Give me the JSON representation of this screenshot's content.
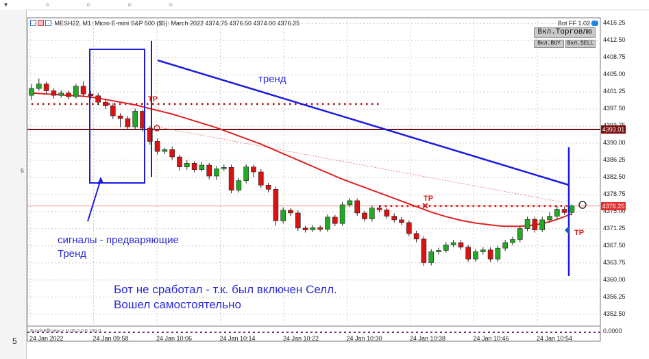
{
  "header": {
    "symbol": "MESH22, M1:",
    "description": "Micro E-mini S&P 500 ($5): March 2022",
    "ohlc": "4374.75 4376.50 4374.00 4376.25"
  },
  "bot": {
    "name": "Bot FF 1.02",
    "trade_button": "Вкл.Торговлю",
    "buy_button": "Вкл.BUY",
    "sell_button": "Вкл.SELL"
  },
  "price_axis": {
    "labels": [
      "4416.25",
      "4412.50",
      "4408.75",
      "4405.00",
      "4401.25",
      "4397.50",
      "4393.75",
      "4390.00",
      "4386.25",
      "4382.50",
      "4378.75",
      "4375.00",
      "4371.25",
      "4367.50",
      "4363.75",
      "4360.00",
      "4356.25",
      "4352.50"
    ],
    "tag_dark": "4393.01",
    "tag_red": "4376.25",
    "bottom_label": "0.0000"
  },
  "time_axis": [
    "24 Jan 2022",
    "24 Jan 09:58",
    "24 Jan 10:06",
    "24 Jan 10:14",
    "24 Jan 10:22",
    "24 Jan 10:30",
    "24 Jan 10:38",
    "24 Jan 10:46",
    "24 Jan 10:54"
  ],
  "annotations": {
    "trend": "тренд",
    "signals_line1": "сигналы - предваряющие",
    "signals_line2": "Тренд",
    "bot_line1": "Бот не сработал - т.к. был включен Селл.",
    "bot_line2": "Вошел самостоятельно",
    "tp": "TP"
  },
  "indicator_label": "FundsEfficiency 1105 0.0 0.100.0",
  "left_marks": [
    "6"
  ],
  "page_number": "5",
  "colors": {
    "bull": "#22aa22",
    "bear": "#dd1111",
    "annotation": "#1a1ae0",
    "ma": "#e02020",
    "dark_level": "#7a0e0e"
  },
  "chart_data": {
    "type": "candlestick",
    "ylim": [
      4350.5,
      4417.5
    ],
    "candles": [
      {
        "o": 4400.5,
        "c": 4402.0,
        "h": 4403.0,
        "l": 4399.5
      },
      {
        "o": 4402.0,
        "c": 4403.0,
        "h": 4404.2,
        "l": 4401.5
      },
      {
        "o": 4403.0,
        "c": 4401.5,
        "h": 4403.5,
        "l": 4400.8
      },
      {
        "o": 4401.5,
        "c": 4400.5,
        "h": 4402.0,
        "l": 4399.8
      },
      {
        "o": 4400.5,
        "c": 4401.0,
        "h": 4401.6,
        "l": 4400.0
      },
      {
        "o": 4401.0,
        "c": 4400.2,
        "h": 4401.5,
        "l": 4399.6
      },
      {
        "o": 4400.2,
        "c": 4402.5,
        "h": 4403.0,
        "l": 4399.8
      },
      {
        "o": 4402.5,
        "c": 4400.8,
        "h": 4403.6,
        "l": 4400.3
      },
      {
        "o": 4400.8,
        "c": 4400.4,
        "h": 4401.4,
        "l": 4399.8
      },
      {
        "o": 4400.4,
        "c": 4399.0,
        "h": 4401.0,
        "l": 4398.4
      },
      {
        "o": 4399.0,
        "c": 4398.2,
        "h": 4399.6,
        "l": 4397.5
      },
      {
        "o": 4398.2,
        "c": 4396.0,
        "h": 4398.8,
        "l": 4395.3
      },
      {
        "o": 4396.0,
        "c": 4395.4,
        "h": 4396.6,
        "l": 4393.5
      },
      {
        "o": 4395.4,
        "c": 4393.6,
        "h": 4396.0,
        "l": 4392.9
      },
      {
        "o": 4393.6,
        "c": 4397.0,
        "h": 4397.6,
        "l": 4393.0
      },
      {
        "o": 4397.0,
        "c": 4393.3,
        "h": 4397.3,
        "l": 4392.5
      },
      {
        "o": 4393.3,
        "c": 4390.4,
        "h": 4393.8,
        "l": 4389.7
      },
      {
        "o": 4390.4,
        "c": 4388.2,
        "h": 4391.0,
        "l": 4387.5
      },
      {
        "o": 4388.2,
        "c": 4388.6,
        "h": 4389.0,
        "l": 4387.6
      },
      {
        "o": 4388.6,
        "c": 4387.0,
        "h": 4389.3,
        "l": 4386.4
      },
      {
        "o": 4387.0,
        "c": 4384.8,
        "h": 4387.5,
        "l": 4384.0
      },
      {
        "o": 4384.8,
        "c": 4385.6,
        "h": 4386.3,
        "l": 4384.2
      },
      {
        "o": 4385.6,
        "c": 4384.2,
        "h": 4386.1,
        "l": 4383.6
      },
      {
        "o": 4384.2,
        "c": 4385.2,
        "h": 4385.9,
        "l": 4383.8
      },
      {
        "o": 4385.2,
        "c": 4382.8,
        "h": 4385.7,
        "l": 4382.1
      },
      {
        "o": 4382.8,
        "c": 4384.4,
        "h": 4385.0,
        "l": 4382.0
      },
      {
        "o": 4384.4,
        "c": 4384.7,
        "h": 4385.3,
        "l": 4383.9
      },
      {
        "o": 4384.7,
        "c": 4379.7,
        "h": 4385.3,
        "l": 4379.0
      },
      {
        "o": 4379.7,
        "c": 4381.8,
        "h": 4382.4,
        "l": 4379.2
      },
      {
        "o": 4381.8,
        "c": 4384.8,
        "h": 4385.4,
        "l": 4381.2
      },
      {
        "o": 4384.8,
        "c": 4383.7,
        "h": 4385.3,
        "l": 4382.6
      },
      {
        "o": 4383.7,
        "c": 4380.8,
        "h": 4384.3,
        "l": 4380.2
      },
      {
        "o": 4380.8,
        "c": 4379.9,
        "h": 4381.3,
        "l": 4379.2
      },
      {
        "o": 4379.9,
        "c": 4373.0,
        "h": 4380.5,
        "l": 4371.9
      },
      {
        "o": 4373.0,
        "c": 4375.3,
        "h": 4375.9,
        "l": 4372.4
      },
      {
        "o": 4375.3,
        "c": 4374.7,
        "h": 4375.8,
        "l": 4374.0
      },
      {
        "o": 4374.7,
        "c": 4371.4,
        "h": 4375.3,
        "l": 4370.8
      },
      {
        "o": 4371.4,
        "c": 4371.0,
        "h": 4371.9,
        "l": 4370.4
      },
      {
        "o": 4371.0,
        "c": 4371.5,
        "h": 4372.1,
        "l": 4370.5
      },
      {
        "o": 4371.5,
        "c": 4371.1,
        "h": 4372.0,
        "l": 4370.6
      },
      {
        "o": 4371.1,
        "c": 4373.8,
        "h": 4374.4,
        "l": 4370.6
      },
      {
        "o": 4373.8,
        "c": 4372.4,
        "h": 4374.3,
        "l": 4371.8
      },
      {
        "o": 4372.4,
        "c": 4376.5,
        "h": 4377.1,
        "l": 4371.9
      },
      {
        "o": 4376.5,
        "c": 4377.4,
        "h": 4378.0,
        "l": 4376.0
      },
      {
        "o": 4377.4,
        "c": 4374.7,
        "h": 4377.9,
        "l": 4374.1
      },
      {
        "o": 4374.7,
        "c": 4373.4,
        "h": 4375.2,
        "l": 4372.8
      },
      {
        "o": 4373.4,
        "c": 4375.8,
        "h": 4376.4,
        "l": 4372.8
      },
      {
        "o": 4375.8,
        "c": 4375.4,
        "h": 4376.4,
        "l": 4374.8
      },
      {
        "o": 4375.4,
        "c": 4374.0,
        "h": 4375.9,
        "l": 4373.4
      },
      {
        "o": 4374.0,
        "c": 4373.2,
        "h": 4374.6,
        "l": 4372.6
      },
      {
        "o": 4373.2,
        "c": 4372.6,
        "h": 4373.8,
        "l": 4372.0
      },
      {
        "o": 4372.6,
        "c": 4370.2,
        "h": 4373.1,
        "l": 4369.6
      },
      {
        "o": 4370.2,
        "c": 4369.0,
        "h": 4370.8,
        "l": 4368.3
      },
      {
        "o": 4369.0,
        "c": 4363.8,
        "h": 4369.6,
        "l": 4363.1
      },
      {
        "o": 4363.8,
        "c": 4366.2,
        "h": 4366.8,
        "l": 4363.2
      },
      {
        "o": 4366.2,
        "c": 4366.5,
        "h": 4367.1,
        "l": 4365.6
      },
      {
        "o": 4366.5,
        "c": 4367.7,
        "h": 4368.3,
        "l": 4366.0
      },
      {
        "o": 4367.7,
        "c": 4368.2,
        "h": 4368.8,
        "l": 4367.2
      },
      {
        "o": 4368.2,
        "c": 4367.2,
        "h": 4368.8,
        "l": 4366.6
      },
      {
        "o": 4367.2,
        "c": 4364.6,
        "h": 4367.7,
        "l": 4364.0
      },
      {
        "o": 4364.6,
        "c": 4366.2,
        "h": 4366.8,
        "l": 4364.0
      },
      {
        "o": 4366.2,
        "c": 4366.6,
        "h": 4367.2,
        "l": 4365.6
      },
      {
        "o": 4366.6,
        "c": 4364.6,
        "h": 4367.2,
        "l": 4364.0
      },
      {
        "o": 4364.6,
        "c": 4367.0,
        "h": 4367.6,
        "l": 4364.0
      },
      {
        "o": 4367.0,
        "c": 4368.2,
        "h": 4368.8,
        "l": 4366.4
      },
      {
        "o": 4368.2,
        "c": 4368.9,
        "h": 4369.5,
        "l": 4367.6
      },
      {
        "o": 4368.9,
        "c": 4371.3,
        "h": 4371.9,
        "l": 4368.3
      },
      {
        "o": 4371.3,
        "c": 4373.3,
        "h": 4373.9,
        "l": 4370.7
      },
      {
        "o": 4373.3,
        "c": 4371.0,
        "h": 4373.9,
        "l": 4370.4
      },
      {
        "o": 4371.0,
        "c": 4373.2,
        "h": 4373.9,
        "l": 4370.5
      },
      {
        "o": 4373.2,
        "c": 4374.0,
        "h": 4374.9,
        "l": 4372.6
      },
      {
        "o": 4374.0,
        "c": 4375.5,
        "h": 4376.2,
        "l": 4373.3
      },
      {
        "o": 4375.5,
        "c": 4374.8,
        "h": 4376.1,
        "l": 4374.3
      },
      {
        "o": 4374.8,
        "c": 4376.3,
        "h": 4376.6,
        "l": 4374.2
      }
    ],
    "ma": [
      4401.0,
      4400.9,
      4400.8,
      4400.7,
      4400.6,
      4400.5,
      4400.4,
      4400.3,
      4400.1,
      4399.9,
      4399.6,
      4399.3,
      4399.0,
      4398.7,
      4398.4,
      4398.0,
      4397.6,
      4397.2,
      4396.8,
      4396.4,
      4395.9,
      4395.4,
      4394.9,
      4394.4,
      4393.9,
      4393.4,
      4392.8,
      4392.2,
      4391.6,
      4391.0,
      4390.4,
      4389.8,
      4389.1,
      4388.4,
      4387.7,
      4387.0,
      4386.3,
      4385.6,
      4384.9,
      4384.2,
      4383.5,
      4382.8,
      4382.1,
      4381.5,
      4380.9,
      4380.3,
      4379.7,
      4379.1,
      4378.5,
      4377.9,
      4377.3,
      4376.7,
      4376.1,
      4375.5,
      4374.9,
      4374.4,
      4373.9,
      4373.5,
      4373.1,
      4372.8,
      4372.5,
      4372.3,
      4372.1,
      4371.9,
      4371.8,
      4371.8,
      4371.8,
      4371.9,
      4372.1,
      4372.4,
      4372.8,
      4373.3,
      4373.9,
      4374.5
    ],
    "levels": [
      {
        "price": 4393.01,
        "style": "solid",
        "color": "#7a0e0e"
      },
      {
        "price": 4376.25,
        "style": "thin",
        "color": "#ee8888"
      },
      {
        "price": 4398.6,
        "style": "dotted",
        "color": "#b02222",
        "from": 0,
        "to": 47
      },
      {
        "price": 4376.25,
        "style": "dotted",
        "color": "#dd2222",
        "from": 47,
        "to": 73
      }
    ]
  }
}
